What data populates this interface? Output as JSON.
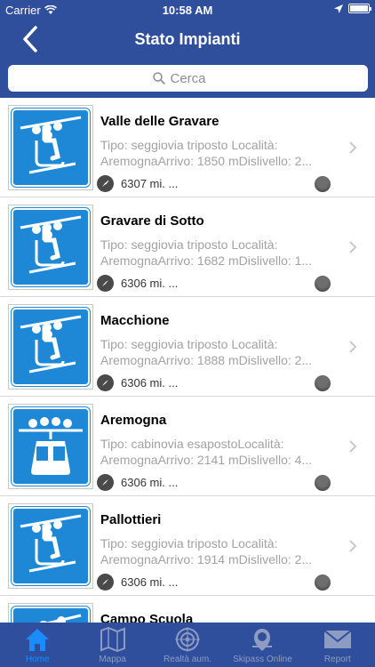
{
  "status_bar": {
    "carrier": "Carrier",
    "time": "10:58 AM"
  },
  "nav": {
    "title": "Stato Impianti"
  },
  "search": {
    "placeholder": "Cerca"
  },
  "lifts": [
    {
      "name": "Valle delle Gravare",
      "desc_line1": "Tipo: seggiovia triposto Località:",
      "desc_line2": "AremognaArrivo: 1850 mDislivello: 2...",
      "distance": "6307 mi. ...",
      "icon": "chairlift-icon"
    },
    {
      "name": "Gravare di Sotto",
      "desc_line1": "Tipo: seggiovia triposto Località:",
      "desc_line2": "AremognaArrivo: 1682 mDislivello: 1...",
      "distance": "6306 mi. ...",
      "icon": "chairlift-icon"
    },
    {
      "name": "Macchione",
      "desc_line1": "Tipo: seggiovia triposto Località:",
      "desc_line2": "AremognaArrivo: 1888 mDislivello: 2...",
      "distance": "6306 mi. ...",
      "icon": "chairlift-icon"
    },
    {
      "name": "Aremogna",
      "desc_line1": "Tipo: cabinovia esapostoLocalità:",
      "desc_line2": "AremognaArrivo: 2141 mDislivello: 4...",
      "distance": "6306 mi. ...",
      "icon": "gondola-icon"
    },
    {
      "name": "Pallottieri",
      "desc_line1": "Tipo: seggiovia triposto Località:",
      "desc_line2": "AremognaArrivo: 1914 mDislivello: 2...",
      "distance": "6306 mi. ...",
      "icon": "chairlift-icon"
    },
    {
      "name": "Campo Scuola",
      "desc_line1": "",
      "desc_line2": "",
      "distance": "",
      "icon": "skilift-icon"
    }
  ],
  "tabs": [
    {
      "label": "Home",
      "icon": "home-icon",
      "active": true
    },
    {
      "label": "Mappa",
      "icon": "map-icon",
      "active": false
    },
    {
      "label": "Realtà aum.",
      "icon": "target-icon",
      "active": false
    },
    {
      "label": "Skipass Online",
      "icon": "skipass-icon",
      "active": false
    },
    {
      "label": "Report",
      "icon": "mail-icon",
      "active": false
    }
  ],
  "colors": {
    "bar": "#2f4f9c",
    "sign_blue": "#1e88d6",
    "tab_active": "#1b8cff"
  }
}
